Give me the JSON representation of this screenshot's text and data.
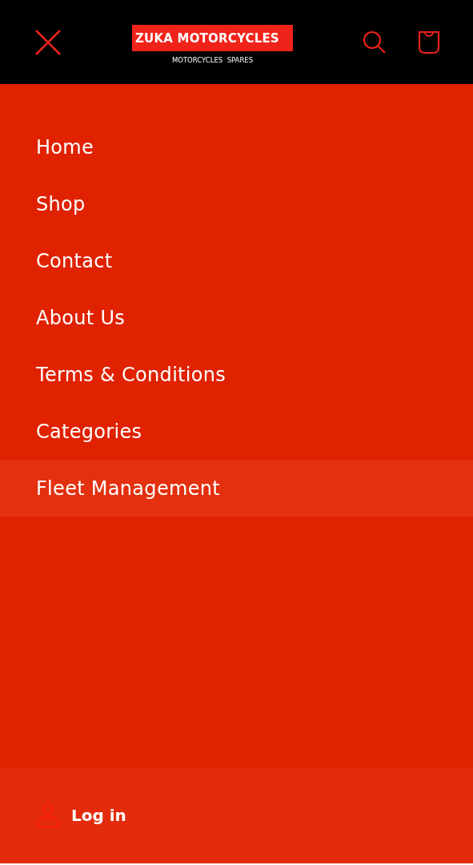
{
  "header": {
    "logo_title": "ZUKA MOTORCYCLES",
    "logo_subtitle": "MOTORCYCLES  SPARES"
  },
  "menu": [
    {
      "label": "Home",
      "selected": false
    },
    {
      "label": "Shop",
      "selected": false
    },
    {
      "label": "Contact",
      "selected": false
    },
    {
      "label": "About Us",
      "selected": false
    },
    {
      "label": "Terms & Conditions",
      "selected": false
    },
    {
      "label": "Categories",
      "selected": false
    },
    {
      "label": "Fleet Management",
      "selected": true
    }
  ],
  "footer": {
    "login": "Log in"
  }
}
